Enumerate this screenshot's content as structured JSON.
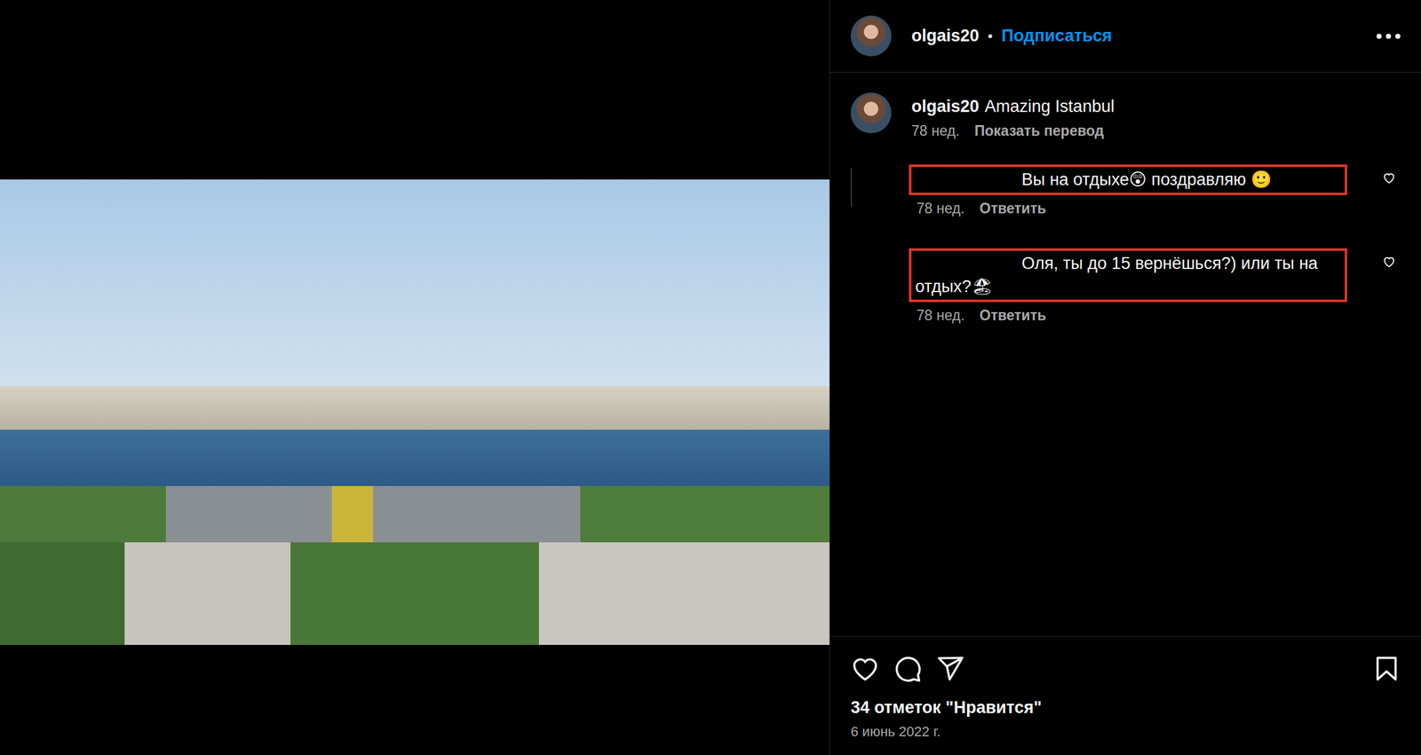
{
  "header": {
    "username": "olgais20",
    "separator": "•",
    "follow": "Подписаться"
  },
  "caption": {
    "username": "olgais20",
    "text": "Amazing Istanbul",
    "time": "78 нед.",
    "translate": "Показать перевод"
  },
  "comments": [
    {
      "text": "Вы на отдыхе😲 поздравляю 🙂",
      "time": "78 нед.",
      "reply": "Ответить",
      "highlighted": true,
      "liked": false
    },
    {
      "text": "Оля, ты до 15 вернёшься?) или ты на отдых?🏖",
      "time": "78 нед.",
      "reply": "Ответить",
      "highlighted": true,
      "liked": false
    }
  ],
  "footer": {
    "likes": "34 отметок \"Нравится\"",
    "date": "6 июнь 2022 г.",
    "liked": false,
    "saved": false
  }
}
